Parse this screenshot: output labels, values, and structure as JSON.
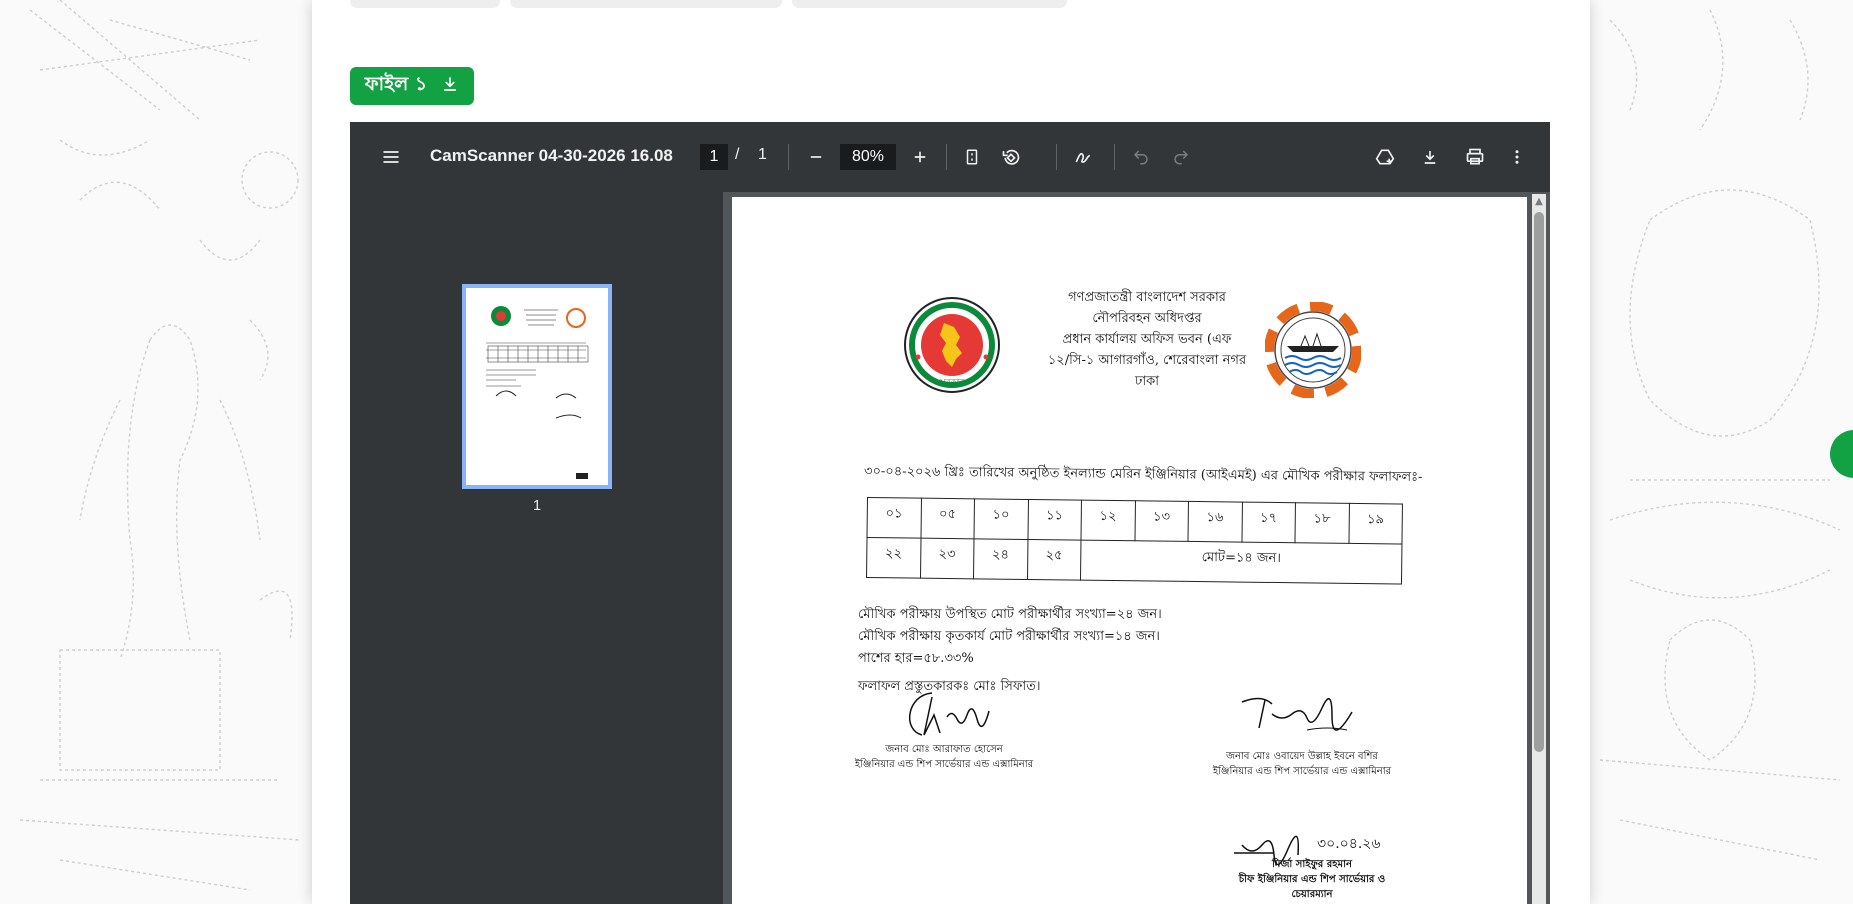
{
  "file_badge": {
    "label": "ফাইল ১",
    "icon": "download-icon"
  },
  "viewer": {
    "toolbar": {
      "menu_icon": "menu-icon",
      "title": "CamScanner 04-30-2026 16.08",
      "page_current": "1",
      "page_separator": "/",
      "page_total": "1",
      "zoom_out_icon": "minus-icon",
      "zoom_value": "80%",
      "zoom_in_icon": "plus-icon",
      "fit_icon": "fit-page-icon",
      "rotate_icon": "rotate-icon",
      "draw_icon": "draw-icon",
      "undo_icon": "undo-icon",
      "redo_icon": "redo-icon",
      "drive_icon": "save-to-drive-icon",
      "download_icon": "download-icon",
      "print_icon": "print-icon",
      "more_icon": "more-vert-icon"
    },
    "sidebar": {
      "thumbnail_label": "1"
    }
  },
  "document": {
    "header_lines": [
      "গণপ্রজাতন্ত্রী বাংলাদেশ সরকার",
      "নৌপরিবহন অধিদপ্তর",
      "প্রধান কার্যালয় অফিস ভবন (এফ",
      "১২/সি-১ আগারগাঁও, শেরেবাংলা নগর",
      "ঢাকা"
    ],
    "seal_left_text": "সরকার",
    "exam_title": "৩০-০৪-২০২৬ খ্রিঃ তারিখের অনুষ্ঠিত ইনল্যান্ড মেরিন ইঞ্জিনিয়ার (আইএমই) এর মৌখিক পরীক্ষার ফলাফলঃ-",
    "table_row1": [
      "০১",
      "০৫",
      "১০",
      "১১",
      "১২",
      "১৩",
      "১৬",
      "১৭",
      "১৮",
      "১৯"
    ],
    "table_row2": [
      "২২",
      "২৩",
      "২৪",
      "২৫"
    ],
    "table_total": "মোট=১৪ জন।",
    "stat_present": "মৌখিক পরীক্ষায় উপস্থিত মোট পরীক্ষার্থীর সংখ্যা=২৪ জন।",
    "stat_passed": "মৌখিক পরীক্ষায় কৃতকার্য মোট পরীক্ষার্থীর সংখ্যা=১৪ জন।",
    "stat_pass_rate": "পাশের হার=৫৮.৩৩%",
    "prepared_by": "ফলাফল প্রস্তুতকারকঃ মোঃ সিফাত।",
    "signer_left": {
      "name": "জনাব মোঃ আরাফাত হোসেন",
      "title": "ইঞ্জিনিয়ার এন্ড শিপ সার্ভেয়ার এন্ড এক্সামিনার"
    },
    "signer_right": {
      "name": "জনাব মোঃ ওবায়েদ উল্লাহ ইবনে বশির",
      "title": "ইঞ্জিনিয়ার এন্ড শিপ সার্ভেয়ার এন্ড এক্সামিনার"
    },
    "signer_chief": {
      "date": "৩০.০৪.২৬",
      "name": "মির্জা সাইফুর রহমান",
      "title": "চীফ ইঞ্জিনিয়ার এন্ড শিপ সার্ভেয়ার ও",
      "title2": "চেয়ারম্যান"
    }
  },
  "colors": {
    "badge_green": "#12a243",
    "toolbar_bg": "#323639",
    "viewer_bg": "#525659",
    "thumb_border": "#8ab4f8"
  }
}
